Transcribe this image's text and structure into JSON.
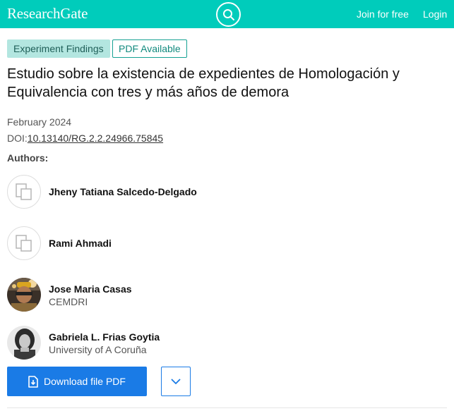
{
  "header": {
    "brand": "ResearchGate",
    "search_icon": "search-icon",
    "join_label": "Join for free",
    "login_label": "Login",
    "background_color": "#00ccbb"
  },
  "tags": {
    "type": "Experiment Findings",
    "pdf": "PDF Available"
  },
  "publication": {
    "title": "Estudio sobre la existencia de expedientes de Homologación y Equivalencia con tres y más años de demora",
    "date": "February 2024",
    "doi_label": "DOI:",
    "doi_value": "10.13140/RG.2.2.24966.75845"
  },
  "authors_heading": "Authors:",
  "authors": [
    {
      "name": "Jheny Tatiana Salcedo-Delgado",
      "affiliation": "",
      "avatar": "placeholder-icon"
    },
    {
      "name": "Rami Ahmadi",
      "affiliation": "",
      "avatar": "placeholder-icon"
    },
    {
      "name": "Jose Maria Casas",
      "affiliation": "CEMDRI",
      "avatar": "photo"
    },
    {
      "name": "Gabriela L. Frias Goytia",
      "affiliation": "University of A Coruña",
      "avatar": "photo"
    }
  ],
  "actions": {
    "download_label": "Download file PDF",
    "download_icon": "download-file-icon",
    "more_icon": "chevron-down-icon",
    "accent_color": "#1a7be6"
  }
}
